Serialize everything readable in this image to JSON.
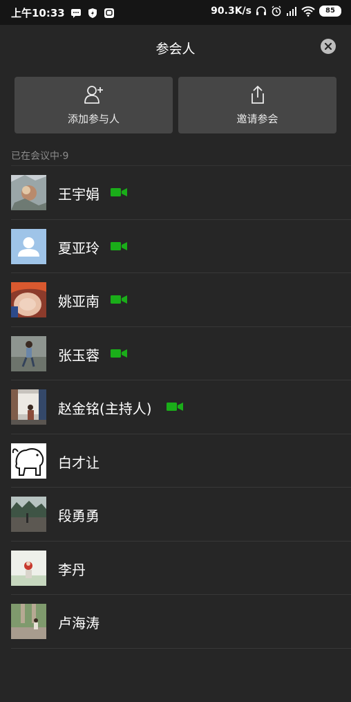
{
  "status_bar": {
    "time": "上午10:33",
    "speed": "90.3K/s",
    "battery": "85"
  },
  "header": {
    "title": "参会人"
  },
  "actions": {
    "add_label": "添加参与人",
    "invite_label": "邀请参会"
  },
  "section": {
    "label": "已在会议中·9"
  },
  "participants": [
    {
      "name": "王宇娟",
      "video": true
    },
    {
      "name": "夏亚玲",
      "video": true
    },
    {
      "name": "姚亚南",
      "video": true
    },
    {
      "name": "张玉蓉",
      "video": true
    },
    {
      "name": "赵金铭(主持人)",
      "video": true
    },
    {
      "name": "白才让",
      "video": false
    },
    {
      "name": "段勇勇",
      "video": false
    },
    {
      "name": "李丹",
      "video": false
    },
    {
      "name": "卢海涛",
      "video": false
    }
  ],
  "colors": {
    "background": "#262626",
    "button": "#464646",
    "video_icon": "#1aad19"
  }
}
